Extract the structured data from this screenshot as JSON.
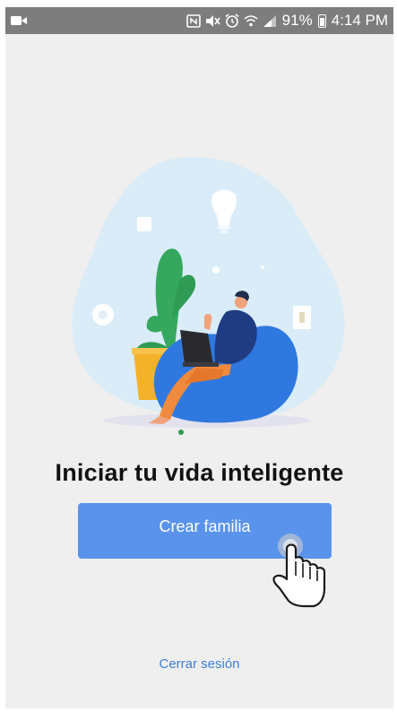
{
  "status_bar": {
    "battery_percent": "91%",
    "time": "4:14 PM",
    "icons": [
      "video-camera-icon",
      "nfc-icon",
      "mute-icon",
      "alarm-icon",
      "wifi-icon",
      "signal-icon",
      "battery-icon"
    ]
  },
  "main": {
    "headline": "Iniciar tu vida inteligente",
    "primary_button_label": "Crear familia",
    "logout_link": "Cerrar sesión"
  },
  "colors": {
    "background": "#efefef",
    "status_bar": "#7d7d7d",
    "primary": "#5a93ec",
    "link": "#3d7fd9",
    "illustration_blob": "#d9ecf8",
    "beanbag": "#2f78e0",
    "plant": "#2f9b54",
    "pot": "#f3b229"
  }
}
